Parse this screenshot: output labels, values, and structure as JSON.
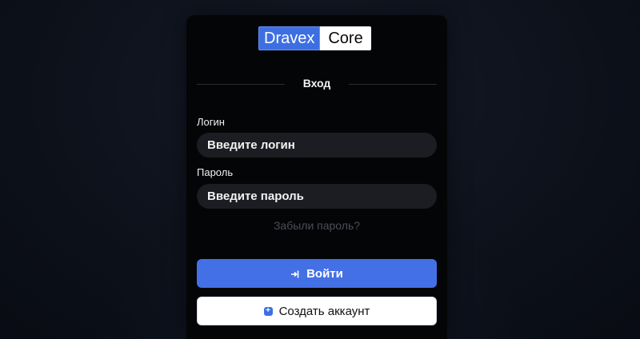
{
  "brand": {
    "part1": "Dravex",
    "part2": "Core",
    "accent_color": "#3d6fe3"
  },
  "form": {
    "title": "Вход",
    "login_label": "Логин",
    "login_placeholder": "Введите логин",
    "password_label": "Пароль",
    "password_placeholder": "Введите пароль",
    "forgot_link": "Забыли пароль?",
    "submit_label": "Войти",
    "submit_icon": "login-icon",
    "register_label": "Создать аккаунт",
    "register_icon": "plus-icon"
  }
}
